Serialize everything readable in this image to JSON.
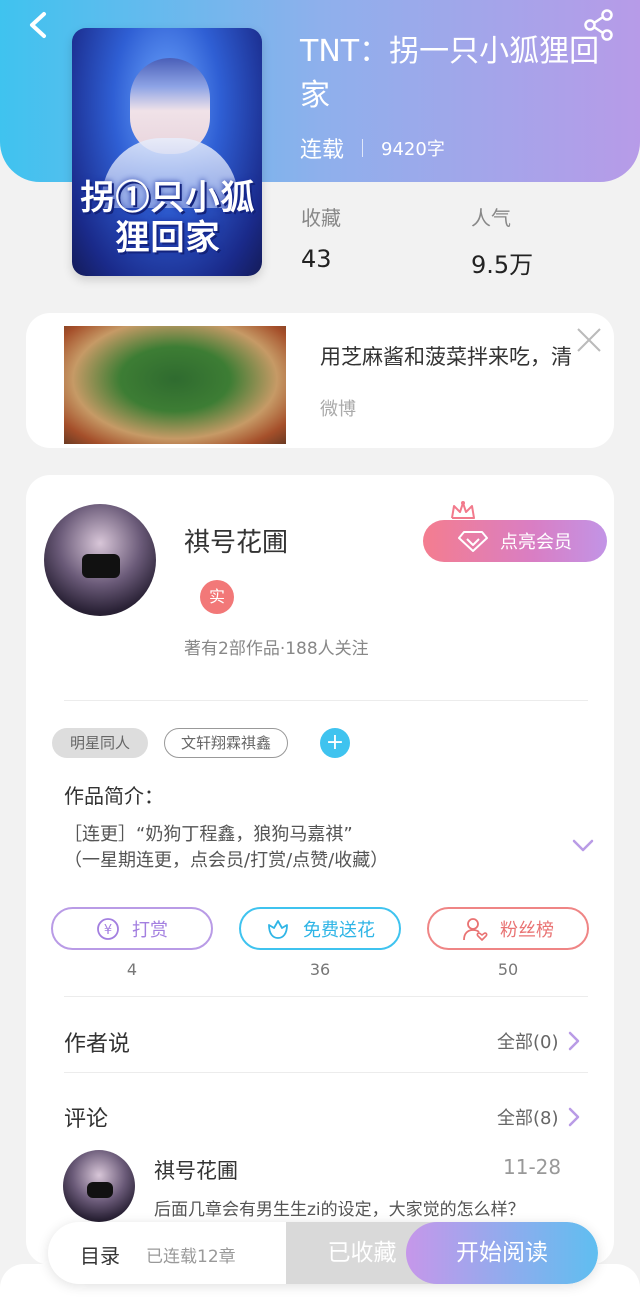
{
  "header": {
    "book_title": "TNT：拐一只小狐狸回家",
    "status": "连载",
    "word_count": "9420字",
    "stats": [
      {
        "label": "收藏",
        "value": "43"
      },
      {
        "label": "人气",
        "value": "9.5万"
      }
    ],
    "cover_text": "拐①只小狐狸回家",
    "icons": {
      "back": "back-chevron-icon",
      "share": "share-icon"
    }
  },
  "ad": {
    "text": "用芝麻酱和菠菜拌来吃，清",
    "source": "微博",
    "close_icon": "close-icon"
  },
  "author": {
    "name": "祺号花圃",
    "badge": "实",
    "meta": "著有2部作品·188人关注",
    "vip_button": "点亮会员"
  },
  "tags": [
    "明星同人",
    "文轩翔霖祺鑫"
  ],
  "tag_add": "+",
  "intro": {
    "title": "作品简介：",
    "text": "［连更］“奶狗丁程鑫，狼狗马嘉祺”\n（一星期连更，点会员/打赏/点赞/收藏）"
  },
  "actions": [
    {
      "label": "打赏",
      "count": "4",
      "icon": "yen-coin-icon"
    },
    {
      "label": "免费送花",
      "count": "36",
      "icon": "flower-icon"
    },
    {
      "label": "粉丝榜",
      "count": "50",
      "icon": "fan-user-icon"
    }
  ],
  "author_say": {
    "title": "作者说",
    "link": "全部(0)"
  },
  "comments": {
    "title": "评论",
    "link": "全部(8)",
    "first": {
      "user": "祺号花圃",
      "date": "11-28",
      "text": "后面几章会有男生生zi的设定，大家觉的怎么样？"
    }
  },
  "bottom_bar": {
    "toc": "目录",
    "progress": "已连载12章",
    "collected": "已收藏",
    "read": "开始阅读"
  },
  "colors": {
    "header_gradient_start": "#3fc3ef",
    "header_gradient_end": "#b79be8",
    "accent_cyan": "#3fc3ef",
    "accent_purple": "#b99be6",
    "accent_red": "#ef8585"
  }
}
